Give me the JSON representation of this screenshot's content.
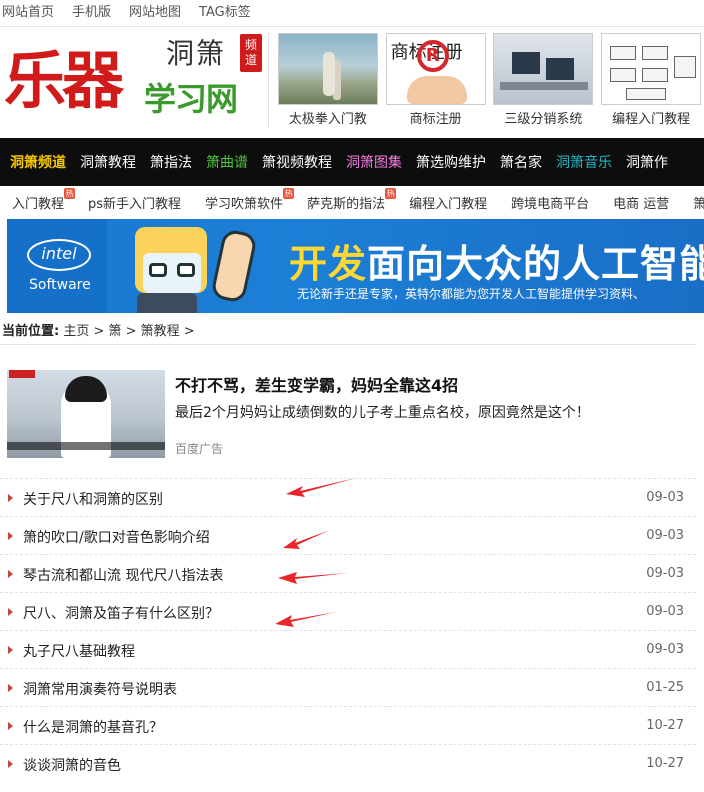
{
  "top_links": [
    "网站首页",
    "手机版",
    "网站地图",
    "TAG标签"
  ],
  "logo": {
    "main": "乐器",
    "sub_top": "洞箫",
    "sub_bottom": "学习网",
    "badge": "频道"
  },
  "thumbs": [
    {
      "caption": "太极拳入门教"
    },
    {
      "caption": "商标注册",
      "image_text": "商标注册",
      "image_symbol": "R"
    },
    {
      "caption": "三级分销系统"
    },
    {
      "caption": "编程入门教程"
    }
  ],
  "nav": [
    {
      "label": "洞箫频道",
      "color": "#f6c600"
    },
    {
      "label": "洞箫教程",
      "color": "#ffffff"
    },
    {
      "label": "箫指法",
      "color": "#ffffff"
    },
    {
      "label": "箫曲谱",
      "color": "#4fc43a"
    },
    {
      "label": "箫视频教程",
      "color": "#ffffff"
    },
    {
      "label": "洞箫图集",
      "color": "#f37adf"
    },
    {
      "label": "箫选购维护",
      "color": "#ffffff"
    },
    {
      "label": "箫名家",
      "color": "#ffffff"
    },
    {
      "label": "洞箫音乐",
      "color": "#22b7c7"
    },
    {
      "label": "洞箫作",
      "color": "#ffffff"
    }
  ],
  "subnav": [
    {
      "label": "入门教程",
      "hot": true
    },
    {
      "label": "ps新手入门教程",
      "hot": false
    },
    {
      "label": "学习吹箫软件",
      "hot": true
    },
    {
      "label": "萨克斯的指法",
      "hot": true
    },
    {
      "label": "编程入门教程",
      "hot": false
    },
    {
      "label": "跨境电商平台",
      "hot": false
    },
    {
      "label": "电商 运营",
      "hot": false
    },
    {
      "label": "箫入",
      "hot": false
    }
  ],
  "hot_badge": "热",
  "banner": {
    "brand": "intel",
    "brand_sub": "Software",
    "title_highlight": "开发",
    "title_rest": "面向大众的人工智能",
    "subtitle": "无论新手还是专家，英特尔都能为您开发人工智能提供学习资料、"
  },
  "breadcrumb": {
    "label": "当前位置:",
    "path": "主页 > 箫 > 箫教程 >"
  },
  "ad": {
    "title": "不打不骂，差生变学霸，妈妈全靠这4招",
    "desc": "最后2个月妈妈让成绩倒数的儿子考上重点名校，原因竟然是这个！",
    "source": "百度广告"
  },
  "articles": [
    {
      "title": "关于尺八和洞箫的区别",
      "date": "09-03"
    },
    {
      "title": "箫的吹口/歌口对音色影响介绍",
      "date": "09-03"
    },
    {
      "title": "琴古流和都山流 现代尺八指法表",
      "date": "09-03"
    },
    {
      "title": "尺八、洞箫及笛子有什么区别？",
      "date": "09-03"
    },
    {
      "title": "丸子尺八基础教程",
      "date": "09-03"
    },
    {
      "title": "洞箫常用演奏符号说明表",
      "date": "01-25"
    },
    {
      "title": "什么是洞箫的基音孔？",
      "date": "10-27"
    },
    {
      "title": "谈谈洞箫的音色",
      "date": "10-27"
    }
  ],
  "accent_colors": {
    "brand_red": "#d11a1a",
    "brand_green": "#3a9a2c",
    "nav_bg": "#0d0d0d",
    "arrow_red": "#e8262b"
  }
}
